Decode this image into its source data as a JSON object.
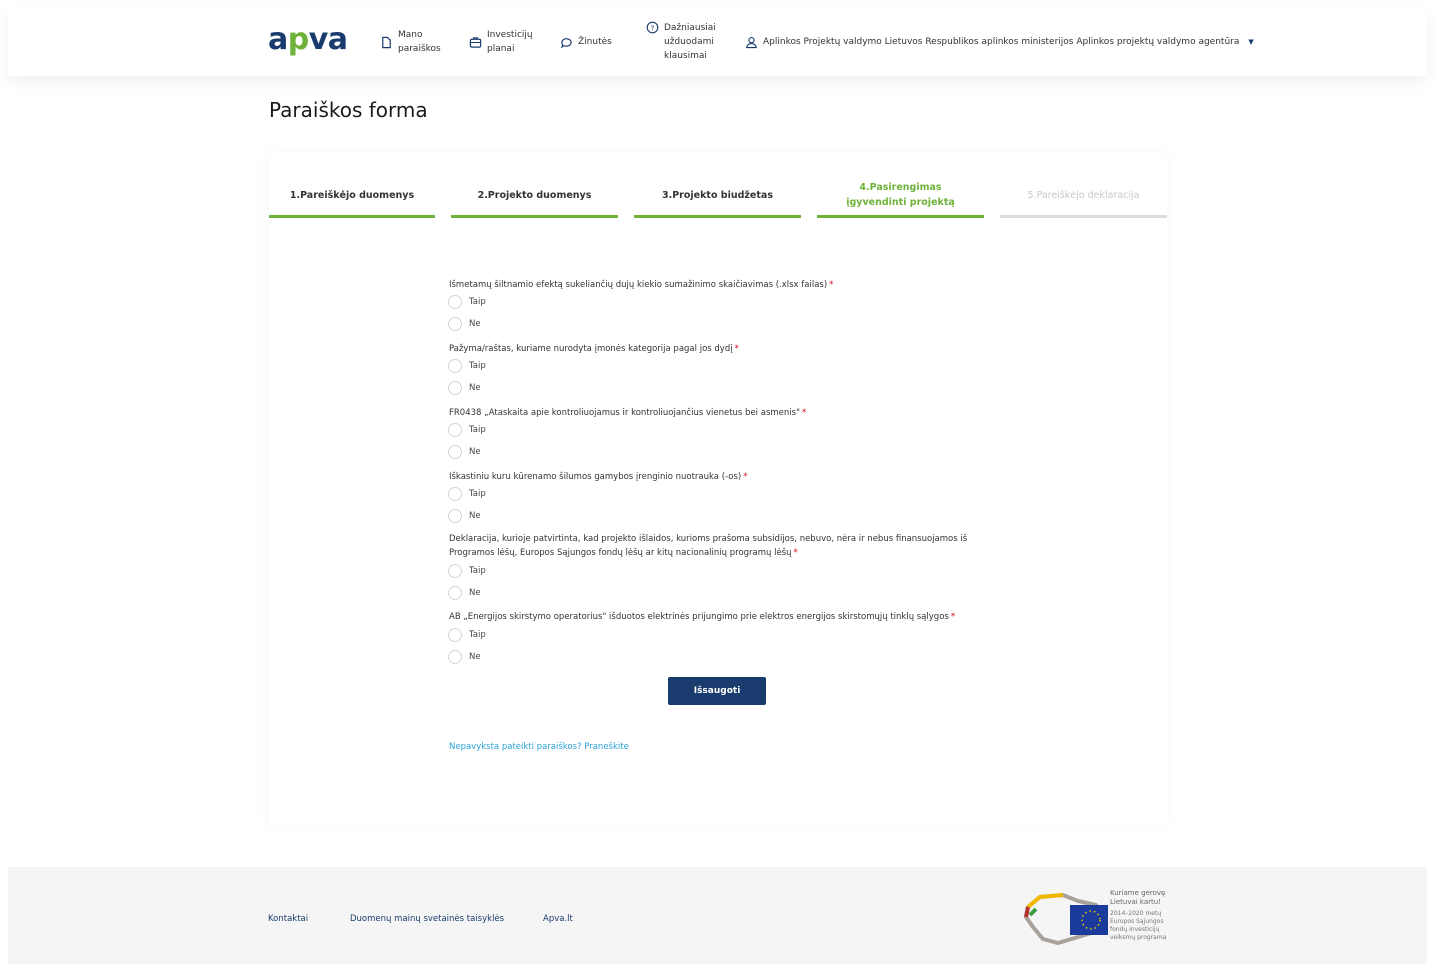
{
  "header": {
    "logo": {
      "a": "a",
      "p": "p",
      "va": "va"
    },
    "nav": [
      {
        "label": "Mano\nparaiškos",
        "icon": "document-icon"
      },
      {
        "label": "Investicijų\nplanai",
        "icon": "briefcase-icon"
      },
      {
        "label": "Žinutės",
        "icon": "message-icon"
      },
      {
        "label": "Dažniausiai\nužduodami\nklausimai",
        "icon": "question-icon"
      }
    ],
    "user": "Aplinkos Projektų valdymo Lietuvos Respublikos aplinkos ministerijos Aplinkos projektų valdymo agentūra"
  },
  "page": {
    "title": "Paraiškos forma"
  },
  "steps": [
    {
      "label": "1.Pareiškėjo duomenys",
      "state": "done"
    },
    {
      "label": "2.Projekto duomenys",
      "state": "done"
    },
    {
      "label": "3.Projekto biudžetas",
      "state": "done"
    },
    {
      "label": "4.Pasirengimas\nįgyvendinti projektą",
      "state": "current"
    },
    {
      "label": "5.Pareiškėjo deklaracija",
      "state": "disabled"
    }
  ],
  "questions": [
    {
      "label": "Išmetamų šiltnamio efektą sukeliančių dujų kiekio sumažinimo skaičiavimas (.xlsx failas)",
      "required": "*"
    },
    {
      "label": "Pažyma/raštas, kuriame nurodyta įmonės kategorija pagal jos dydį",
      "required": "*"
    },
    {
      "label": "FR0438 „Ataskaita apie kontroliuojamus ir kontroliuojančius vienetus bei asmenis\"",
      "required": "*"
    },
    {
      "label": "Iškastiniu kuru kūrenamo šilumos gamybos įrenginio nuotrauka (-os)",
      "required": "*"
    },
    {
      "label": "Deklaracija, kurioje patvirtinta, kad projekto išlaidos, kurioms prašoma subsidijos, nebuvo, nėra ir nebus finansuojamos iš Programos lėšų, Europos Sąjungos fondų lėšų ar kitų nacionalinių programų lėšų",
      "required": "*"
    },
    {
      "label": "AB „Energijos skirstymo operatorius\" išduotos elektrinės prijungimo prie elektros energijos skirstomųjų tinklų sąlygos",
      "required": "*"
    }
  ],
  "options": {
    "yes": "Taip",
    "no": "Ne"
  },
  "form": {
    "save_label": "Išsaugoti",
    "report_link": "Nepavyksta pateikti paraiškos? Praneškite"
  },
  "footer": {
    "links": [
      "Kontaktai",
      "Duomenų mainų svetainės taisyklės",
      "Apva.lt"
    ],
    "eu_title": "Kuriame gerovę\nLietuvai kartu!",
    "eu_sub": "2014–2020 metų\nEuropos Sąjungos\nfondų investicijų\nveiksmų programa"
  },
  "colors": {
    "brand": "#1a3b6e",
    "accent": "#6fb23a",
    "link": "#2aa3d6",
    "required": "#d0021b"
  }
}
